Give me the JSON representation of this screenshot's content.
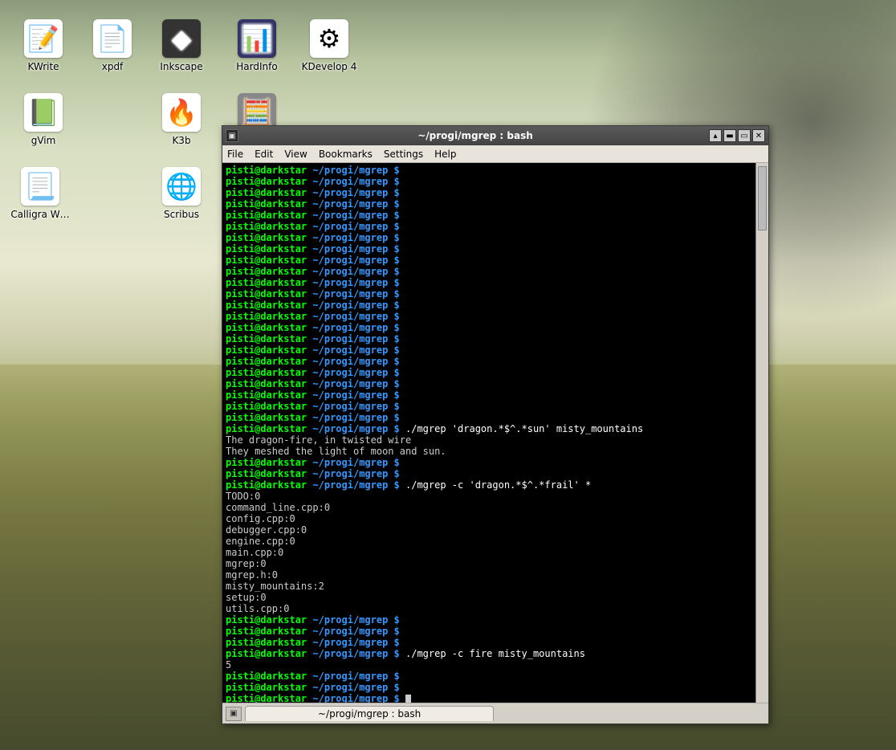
{
  "desktop": {
    "icons": [
      {
        "id": "kwrite",
        "label": "KWrite",
        "glyph": "📝"
      },
      {
        "id": "xpdf",
        "label": "xpdf",
        "glyph": "📄"
      },
      {
        "id": "inkscape",
        "label": "Inkscape",
        "glyph": "◆"
      },
      {
        "id": "hardinfo",
        "label": "HardInfo",
        "glyph": "📊"
      },
      {
        "id": "kdevelop",
        "label": "KDevelop 4",
        "glyph": "⚙"
      },
      {
        "id": "gvim",
        "label": "gVim",
        "glyph": "📗"
      },
      {
        "id": "k3b",
        "label": "K3b",
        "glyph": "🔥"
      },
      {
        "id": "kcalc",
        "label": "",
        "glyph": "🧮"
      },
      {
        "id": "calligra",
        "label": "Calligra W…",
        "glyph": "📃"
      },
      {
        "id": "scribus",
        "label": "Scribus",
        "glyph": "🌐"
      }
    ]
  },
  "window": {
    "title": "~/progi/mgrep : bash",
    "menu": [
      "File",
      "Edit",
      "View",
      "Bookmarks",
      "Settings",
      "Help"
    ],
    "tab_label": "~/progi/mgrep : bash"
  },
  "prompt": {
    "userhost": "pisti@darkstar",
    "cwd": "~/progi/mgrep",
    "sigil": "$"
  },
  "commands": {
    "cmd1": "./mgrep 'dragon.*$^.*sun' misty_mountains",
    "cmd2": "./mgrep -c 'dragon.*$^.*frail' *",
    "cmd3": "./mgrep -c fire misty_mountains"
  },
  "output1": [
    "The dragon-fire, in twisted wire",
    "They meshed the light of moon and sun."
  ],
  "output2": [
    "TODO:0",
    "command_line.cpp:0",
    "config.cpp:0",
    "debugger.cpp:0",
    "engine.cpp:0",
    "main.cpp:0",
    "mgrep:0",
    "mgrep.h:0",
    "misty_mountains:2",
    "setup:0",
    "utils.cpp:0"
  ],
  "output3": [
    "5"
  ],
  "empty_prompts_before_cmd1": 23,
  "empty_prompts_after_cmd1": 2,
  "empty_prompts_after_cmd2": 3,
  "empty_prompts_after_cmd3": 2
}
